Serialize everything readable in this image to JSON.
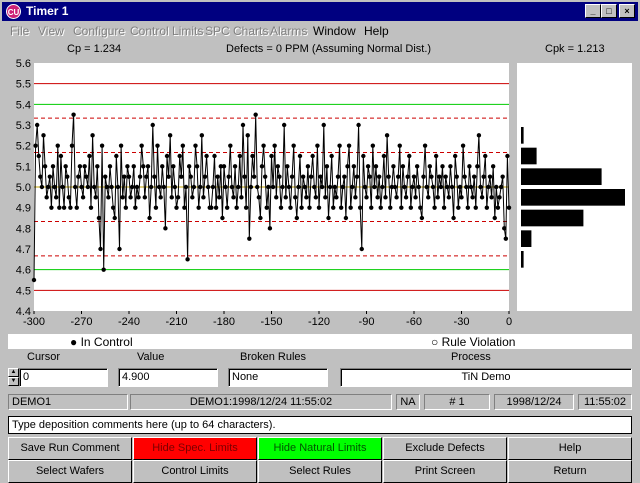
{
  "window": {
    "title": "Timer 1",
    "icon_text": "CU",
    "controls": [
      "_",
      "□",
      "×"
    ]
  },
  "menu": [
    {
      "label": "File",
      "enabled": false
    },
    {
      "label": "View",
      "enabled": false
    },
    {
      "label": "Configure",
      "enabled": false
    },
    {
      "label": "Control Limits",
      "enabled": false
    },
    {
      "label": "SPC Charts",
      "enabled": false
    },
    {
      "label": "Alarms",
      "enabled": false
    },
    {
      "label": "Window",
      "enabled": true
    },
    {
      "label": "Help",
      "enabled": true
    }
  ],
  "stats": {
    "cp": "Cp = 1.234",
    "defects": "Defects = 0 PPM (Assuming Normal Dist.)",
    "cpk": "Cpk = 1.213"
  },
  "chart_data": {
    "type": "line",
    "title": "",
    "xlabel": "",
    "ylabel": "",
    "xlim": [
      -300,
      0
    ],
    "ylim": [
      4.4,
      5.6
    ],
    "x_ticks": [
      -300,
      -270,
      -240,
      -210,
      -180,
      -150,
      -120,
      -90,
      -60,
      -30,
      0
    ],
    "y_ticks": [
      4.4,
      4.5,
      4.6,
      4.7,
      4.8,
      4.9,
      5.0,
      5.1,
      5.2,
      5.3,
      5.4,
      5.5,
      5.6
    ],
    "spec_limits": [
      4.5,
      5.5
    ],
    "natural_limits": [
      4.6,
      5.4
    ],
    "control_limits_dashed": [
      4.667,
      4.833,
      5.167,
      5.333
    ],
    "center_line": 5.0,
    "center_line_color": "#c0a000",
    "spec_color": "#cc0000",
    "natural_color": "#00cc00",
    "control_color": "#cc0000",
    "series": [
      {
        "values": [
          4.55,
          5.2,
          5.3,
          5.15,
          5.05,
          5.0,
          5.25,
          5.1,
          4.95,
          5.0,
          5.05,
          4.9,
          5.1,
          5.0,
          4.95,
          5.2,
          4.9,
          5.15,
          5.0,
          4.9,
          5.1,
          5.05,
          4.95,
          4.9,
          5.2,
          5.35,
          5.0,
          4.9,
          5.05,
          5.1,
          5.0,
          4.95,
          5.1,
          5.05,
          5.0,
          5.15,
          4.9,
          5.25,
          5.0,
          4.95,
          5.1,
          4.85,
          4.7,
          5.2,
          4.6,
          5.05,
          5.0,
          4.95,
          5.1,
          5.0,
          4.9,
          4.85,
          5.15,
          5.0,
          4.7,
          5.2,
          4.95,
          5.05,
          4.9,
          5.1,
          5.05,
          4.95,
          5.0,
          5.1,
          4.9,
          5.0,
          4.95,
          5.05,
          5.2,
          5.1,
          4.95,
          5.05,
          5.1,
          4.85,
          5.0,
          5.3,
          5.05,
          4.9,
          5.2,
          5.0,
          4.95,
          5.1,
          5.0,
          4.8,
          5.15,
          5.05,
          5.25,
          4.95,
          5.1,
          5.0,
          4.9,
          4.95,
          5.15,
          5.05,
          5.2,
          4.9,
          5.0,
          4.65,
          5.1,
          5.05,
          4.95,
          5.0,
          5.2,
          5.1,
          4.9,
          5.0,
          5.25,
          4.95,
          5.05,
          5.15,
          5.0,
          4.9,
          4.9,
          5.0,
          5.15,
          4.9,
          5.05,
          4.95,
          5.1,
          4.85,
          5.1,
          5.0,
          4.9,
          5.05,
          5.2,
          5.0,
          4.95,
          5.1,
          4.9,
          5.0,
          5.15,
          4.95,
          5.3,
          5.05,
          4.9,
          5.25,
          4.75,
          5.0,
          5.15,
          5.05,
          5.35,
          5.0,
          4.95,
          4.85,
          5.1,
          5.2,
          5.05,
          4.9,
          5.0,
          4.8,
          5.15,
          5.0,
          5.2,
          4.95,
          5.1,
          5.05,
          4.9,
          5.0,
          5.3,
          4.95,
          5.1,
          5.0,
          4.9,
          5.05,
          5.2,
          4.95,
          4.85,
          5.0,
          5.15,
          4.9,
          5.05,
          5.0,
          4.95,
          5.1,
          4.9,
          5.05,
          5.15,
          5.0,
          4.95,
          5.2,
          4.9,
          5.05,
          5.0,
          5.3,
          4.95,
          5.1,
          4.85,
          5.0,
          5.15,
          4.9,
          5.0,
          4.95,
          5.05,
          5.2,
          4.9,
          5.0,
          5.05,
          4.85,
          5.1,
          5.2,
          4.9,
          5.0,
          5.1,
          4.95,
          5.05,
          5.3,
          4.9,
          4.7,
          5.15,
          5.0,
          4.95,
          5.1,
          5.05,
          4.9,
          5.2,
          5.0,
          5.1,
          4.95,
          5.05,
          4.9,
          5.0,
          5.15,
          4.95,
          5.25,
          5.05,
          4.9,
          5.0,
          5.1,
          5.0,
          4.95,
          5.05,
          5.2,
          4.9,
          5.1,
          5.0,
          4.95,
          5.05,
          5.15,
          4.9,
          5.0,
          5.05,
          4.95,
          5.1,
          5.0,
          4.9,
          4.85,
          5.05,
          5.2,
          5.0,
          4.95,
          5.1,
          5.05,
          5.0,
          4.9,
          5.15,
          4.95,
          5.05,
          5.0,
          5.1,
          4.9,
          5.05,
          5.0,
          4.95,
          5.1,
          5.0,
          4.85,
          5.15,
          5.05,
          4.9,
          5.0,
          4.95,
          5.2,
          5.05,
          5.0,
          4.9,
          5.1,
          5.0,
          4.95,
          5.05,
          4.9,
          5.1,
          5.25,
          5.0,
          4.95,
          5.05,
          5.15,
          4.9,
          5.0,
          5.05,
          4.95,
          5.1,
          4.85,
          5.0,
          4.9,
          4.95,
          5.0,
          5.05,
          4.8,
          4.75,
          5.15,
          4.9
        ]
      }
    ],
    "histogram": {
      "bins": [
        4.6,
        4.7,
        4.8,
        4.9,
        5.0,
        5.1,
        5.2,
        5.3,
        5.4
      ],
      "counts": [
        2,
        8,
        48,
        80,
        62,
        12,
        2,
        0,
        0
      ]
    },
    "legend": [
      "In Control",
      "Rule Violation"
    ]
  },
  "fields": {
    "cursor": {
      "label": "Cursor",
      "value": "0"
    },
    "value": {
      "label": "Value",
      "value": "4.900"
    },
    "broken_rules": {
      "label": "Broken Rules",
      "value": "None"
    },
    "process": {
      "label": "Process",
      "value": "TiN Demo"
    }
  },
  "status": {
    "station": "DEMO1",
    "record": "DEMO1:1998/12/24 11:55:02",
    "na": "NA",
    "number": "# 1",
    "date": "1998/12/24",
    "time": "11:55:02"
  },
  "comment": {
    "placeholder": "Type deposition comments here (up to 64 characters)."
  },
  "buttons_row1": [
    {
      "label": "Save Run Comment",
      "style": "normal"
    },
    {
      "label": "Hide Spec. Limits",
      "style": "red"
    },
    {
      "label": "Hide Natural Limits",
      "style": "green"
    },
    {
      "label": "Exclude Defects",
      "style": "normal"
    },
    {
      "label": "Help",
      "style": "normal"
    }
  ],
  "buttons_row2": [
    {
      "label": "Select Wafers",
      "style": "normal"
    },
    {
      "label": "Control Limits",
      "style": "normal"
    },
    {
      "label": "Select Rules",
      "style": "normal"
    },
    {
      "label": "Print Screen",
      "style": "normal"
    },
    {
      "label": "Return",
      "style": "normal"
    }
  ]
}
